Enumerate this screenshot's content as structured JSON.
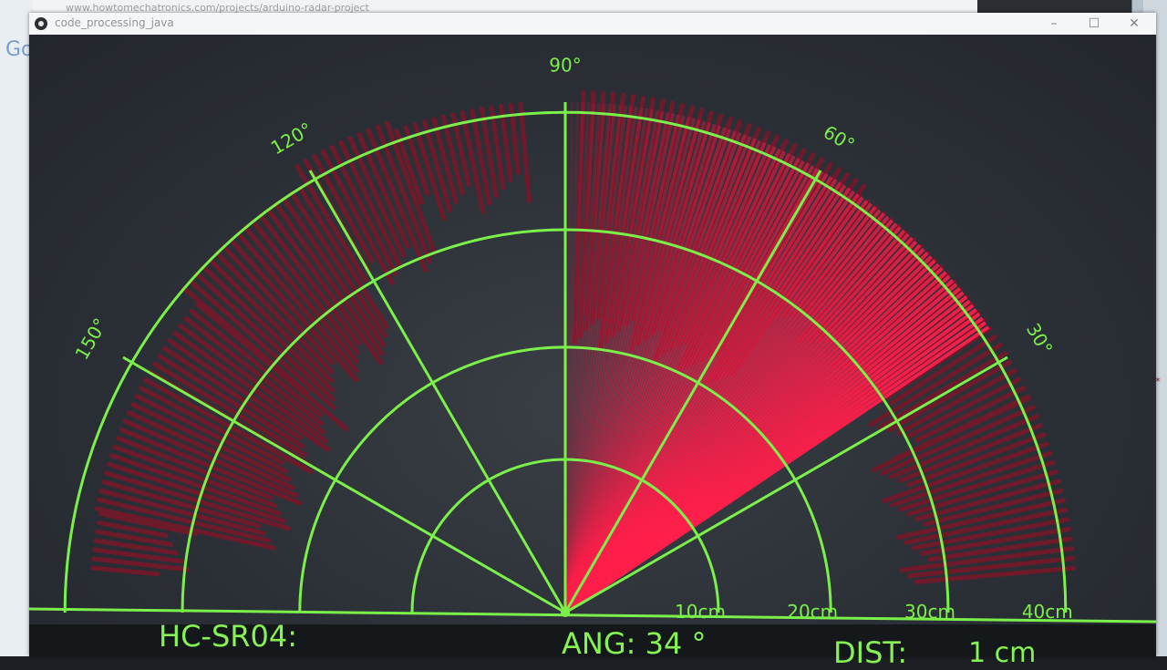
{
  "browser": {
    "address_text": "www.howtomechatronics.com/projects/arduino-radar-project"
  },
  "window": {
    "title": "code_processing_java",
    "min_glyph": "–",
    "max_glyph": "☐",
    "close_glyph": "✕"
  },
  "side": {
    "left_logo_fragment": "Go",
    "right_text_fragment": "nt*"
  },
  "radar": {
    "angle_labels": [
      "30°",
      "60°",
      "90°",
      "120°",
      "150°"
    ],
    "distance_labels": [
      "10cm",
      "20cm",
      "30cm",
      "40cm"
    ],
    "current_angle_deg": 34,
    "accent_color": "#7cf04a",
    "sweep_color": "#ff1f4b",
    "object_color": "#6e1a2b"
  },
  "status": {
    "sensor_label": "HC-SR04:",
    "angle_label": "ANG: 34 °",
    "distance_label": "DIST:",
    "distance_value": "1 cm"
  }
}
